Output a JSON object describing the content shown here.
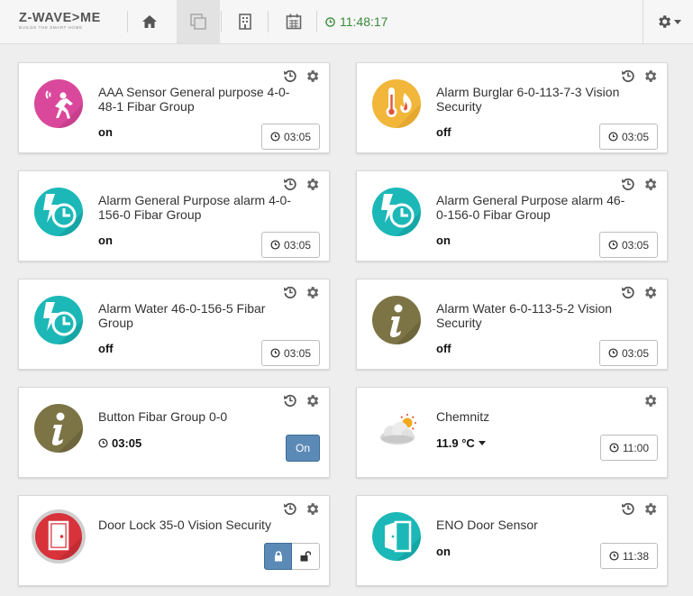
{
  "header": {
    "logo_main": "Z-WAVE>ME",
    "logo_sub": "BUILDS THE SMART HOME",
    "clock": "11:48:17",
    "nav": [
      "home-icon",
      "elements-icon",
      "rooms-icon",
      "events-icon"
    ],
    "colors": {
      "clock": "#3a8a3a"
    }
  },
  "widgets": [
    {
      "title": "AAA Sensor General purpose 4-0-48-1 Fibar Group",
      "level": "on",
      "time": "03:05",
      "icon": "motion-sensor-icon",
      "icon_color": "#d9489b"
    },
    {
      "title": "Alarm Burglar 6-0-113-7-3 Vision Security",
      "level": "off",
      "time": "03:05",
      "icon": "temperature-fire-icon",
      "icon_color": "#f1b63a"
    },
    {
      "title": "Alarm General Purpose alarm 4-0-156-0 Fibar Group",
      "level": "on",
      "time": "03:05",
      "icon": "alarm-bolt-clock-icon",
      "icon_color": "#1cb8b8"
    },
    {
      "title": "Alarm General Purpose alarm 46-0-156-0 Fibar Group",
      "level": "on",
      "time": "03:05",
      "icon": "alarm-bolt-clock-icon",
      "icon_color": "#1cb8b8"
    },
    {
      "title": "Alarm Water 46-0-156-5 Fibar Group",
      "level": "off",
      "time": "03:05",
      "icon": "alarm-bolt-clock-icon",
      "icon_color": "#1cb8b8"
    },
    {
      "title": "Alarm Water 6-0-113-5-2 Vision Security",
      "level": "off",
      "time": "03:05",
      "icon": "info-icon",
      "icon_color": "#7d7446"
    },
    {
      "title": "Button Fibar Group 0-0",
      "level": "03:05",
      "button": "On",
      "icon": "info-icon",
      "icon_color": "#7d7446"
    },
    {
      "title": "Chemnitz",
      "level": "11.9 °C",
      "time": "11:00",
      "icon": "weather-cloud-sun-icon"
    },
    {
      "title": "Door Lock 35-0 Vision Security",
      "icon": "door-lock-icon",
      "icon_color": "#d8323a"
    },
    {
      "title": "ENO Door Sensor",
      "level": "on",
      "time": "11:38",
      "icon": "door-open-icon",
      "icon_color": "#1cb8b8"
    }
  ]
}
